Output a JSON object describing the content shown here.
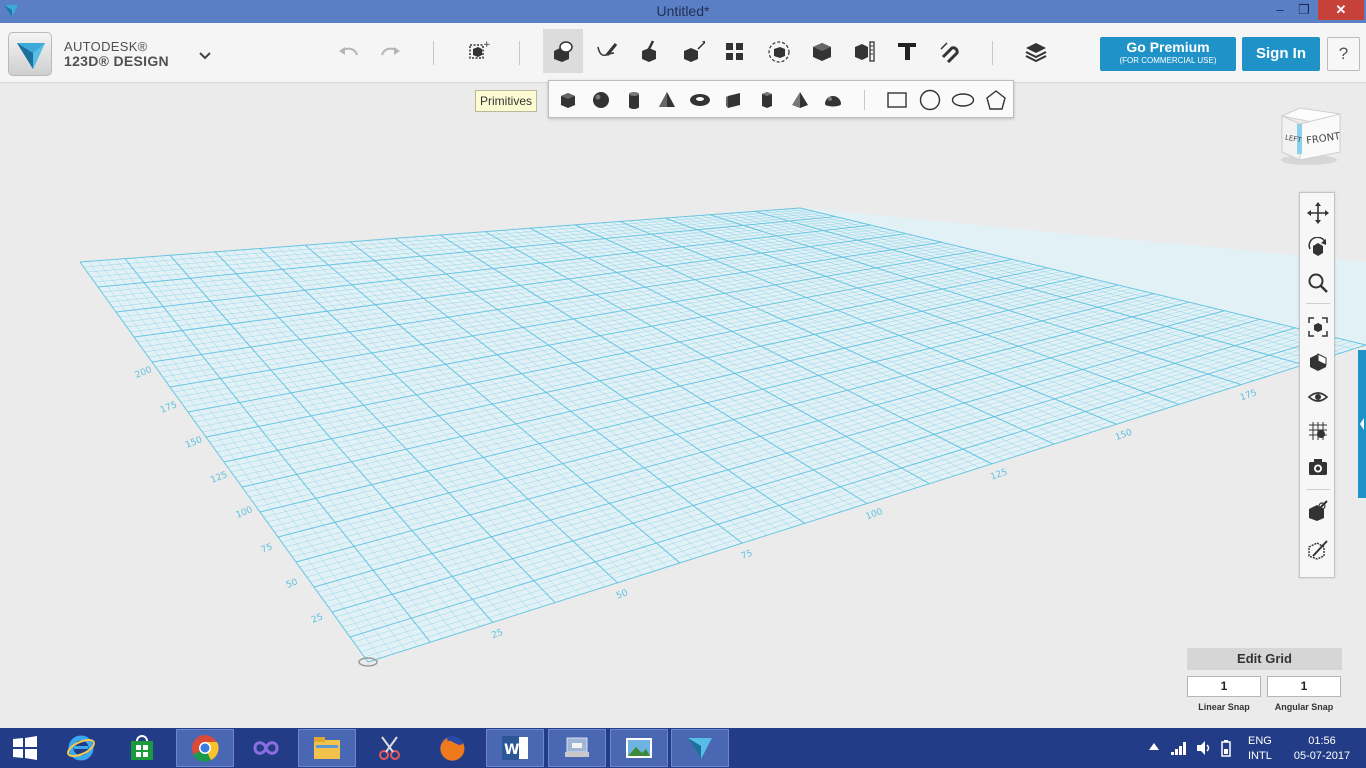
{
  "window": {
    "title": "Untitled*",
    "minimize": "–",
    "maximize": "❐",
    "close": "✕"
  },
  "brand": {
    "line1": "AUTODESK®",
    "line2": "123D® DESIGN"
  },
  "toolbar": {
    "undo": "undo-icon",
    "redo": "redo-icon",
    "tools": [
      "transform",
      "primitives",
      "sketch",
      "construct",
      "modify",
      "pattern",
      "group",
      "combine",
      "measure",
      "text",
      "snap",
      "material"
    ]
  },
  "tooltip": {
    "text": "Primitives"
  },
  "primitives": {
    "items": [
      "box",
      "sphere",
      "cylinder",
      "cone",
      "torus",
      "wedge",
      "prism",
      "pyramid",
      "hemisphere",
      "rectangle",
      "circle",
      "ellipse",
      "polygon"
    ]
  },
  "premium": {
    "label": "Go Premium",
    "sub": "(FOR COMMERCIAL USE)"
  },
  "signin": {
    "label": "Sign In"
  },
  "help": {
    "label": "?"
  },
  "viewcube": {
    "left": "LEFT",
    "front": "FRONT"
  },
  "grid": {
    "left_axis_labels": [
      "25",
      "50",
      "75",
      "100",
      "125",
      "150",
      "175",
      "200"
    ],
    "front_axis_labels": [
      "25",
      "50",
      "75",
      "100",
      "125",
      "150",
      "175"
    ]
  },
  "editgrid": {
    "title": "Edit Grid",
    "linear_value": "1",
    "angular_value": "1",
    "linear_label": "Linear Snap",
    "angular_label": "Angular Snap"
  },
  "taskbar": {
    "lang1": "ENG",
    "lang2": "INTL",
    "time": "01:56",
    "date": "05-07-2017"
  },
  "colors": {
    "accent": "#1f93c7",
    "grid": "#5cc1e0",
    "titlebar": "#5b7fc5",
    "taskbar": "#233c87"
  }
}
